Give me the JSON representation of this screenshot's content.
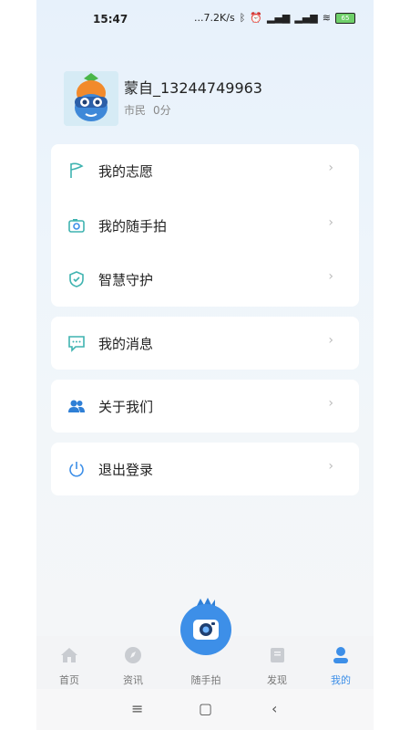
{
  "status_bar": {
    "time": "15:47",
    "speed": "...7.2K/s",
    "battery": "65"
  },
  "profile": {
    "name": "蒙自_13244749963",
    "role": "市民",
    "points": "0分"
  },
  "menu": [
    {
      "label": "我的志愿",
      "icon": "flag-icon"
    },
    {
      "label": "我的随手拍",
      "icon": "camera-icon"
    },
    {
      "label": "智慧守护",
      "icon": "shield-icon"
    },
    {
      "label": "我的消息",
      "icon": "message-icon"
    },
    {
      "label": "关于我们",
      "icon": "people-icon"
    },
    {
      "label": "退出登录",
      "icon": "power-icon"
    }
  ],
  "chevron": "›",
  "tabs": [
    {
      "label": "首页",
      "icon": "home-icon"
    },
    {
      "label": "资讯",
      "icon": "compass-icon"
    },
    {
      "label": "随手拍",
      "icon": "camera-mascot-icon"
    },
    {
      "label": "发现",
      "icon": "book-icon"
    },
    {
      "label": "我的",
      "icon": "person-icon"
    }
  ],
  "colors": {
    "accent": "#3d8fe8",
    "inactive": "#777777",
    "icon_teal": "#3fb3b0"
  },
  "nav": {
    "menu": "≡",
    "home": "▢",
    "back": "‹"
  }
}
